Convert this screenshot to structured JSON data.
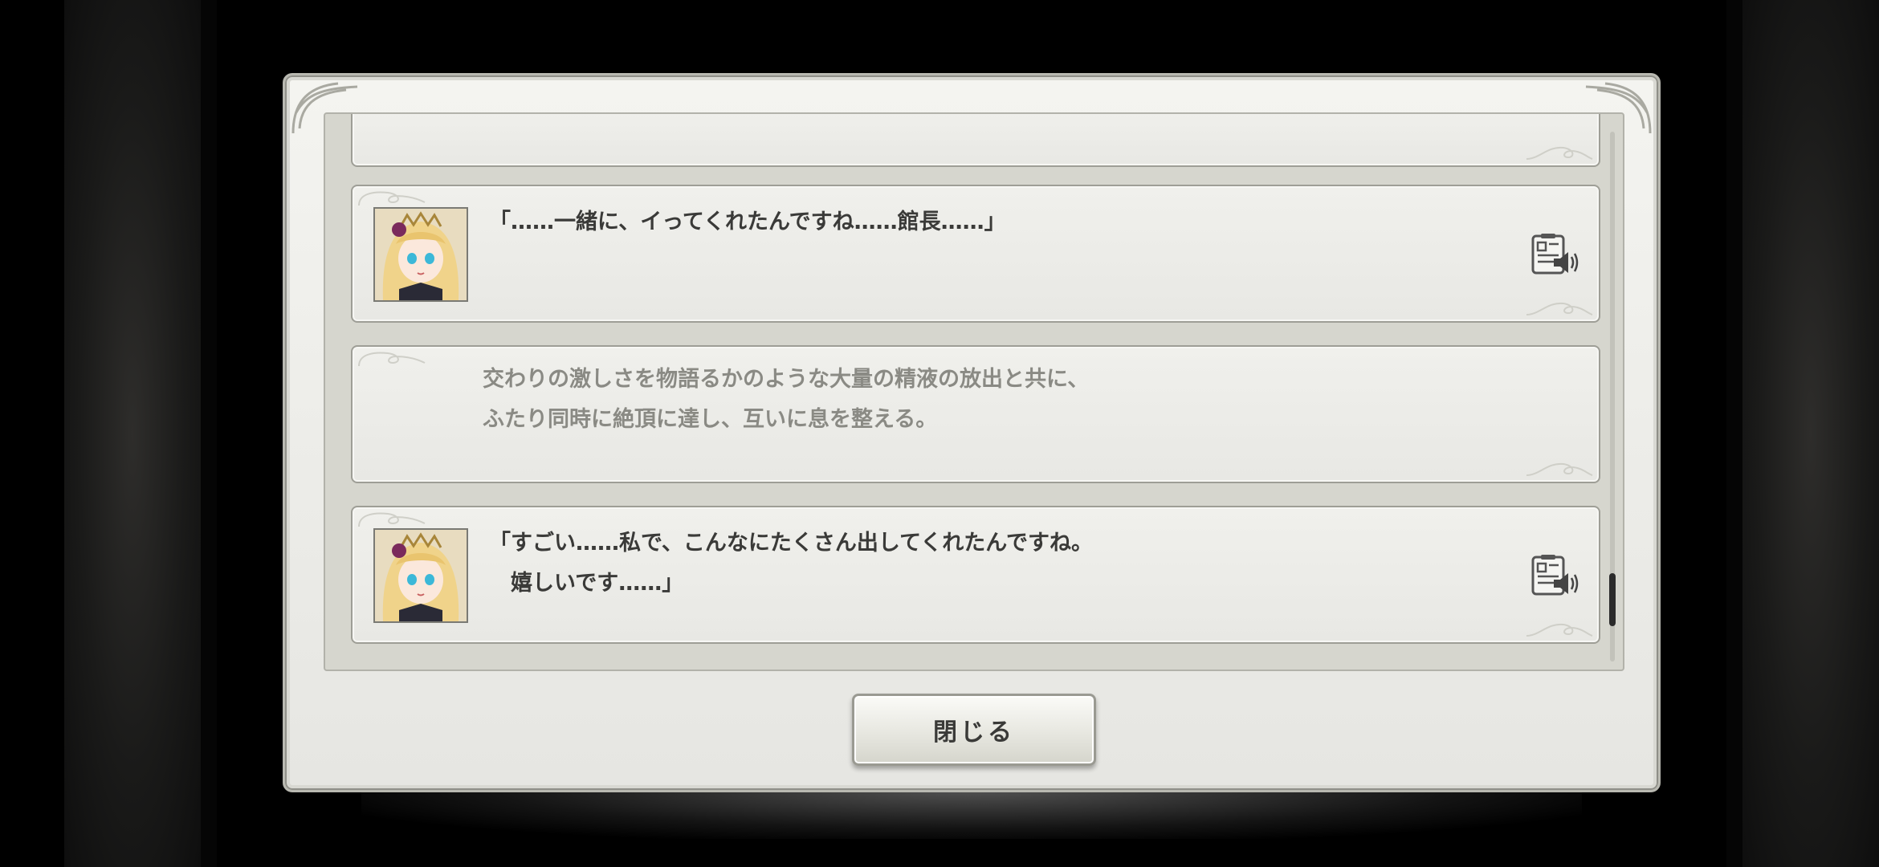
{
  "log": {
    "entries": [
      {
        "type": "dialogue",
        "lines": [
          "「……一緒に、イってくれたんですね……館長……」"
        ],
        "has_voice": true
      },
      {
        "type": "narration",
        "lines": [
          "交わりの激しさを物語るかのような大量の精液の放出と共に、",
          "ふたり同時に絶頂に達し、互いに息を整える。"
        ]
      },
      {
        "type": "dialogue",
        "lines": [
          "「すごい……私で、こんなにたくさん出してくれたんですね。",
          "　嬉しいです……」"
        ],
        "has_voice": true
      }
    ]
  },
  "close_button": {
    "label": "閉じる"
  },
  "colors": {
    "frame": "#b9b9b1",
    "panel": "#ececE8",
    "text": "#3a3a38",
    "narration": "#8a8a84"
  },
  "icons": {
    "voice": "voice-replay-icon",
    "portrait": "character-portrait"
  }
}
